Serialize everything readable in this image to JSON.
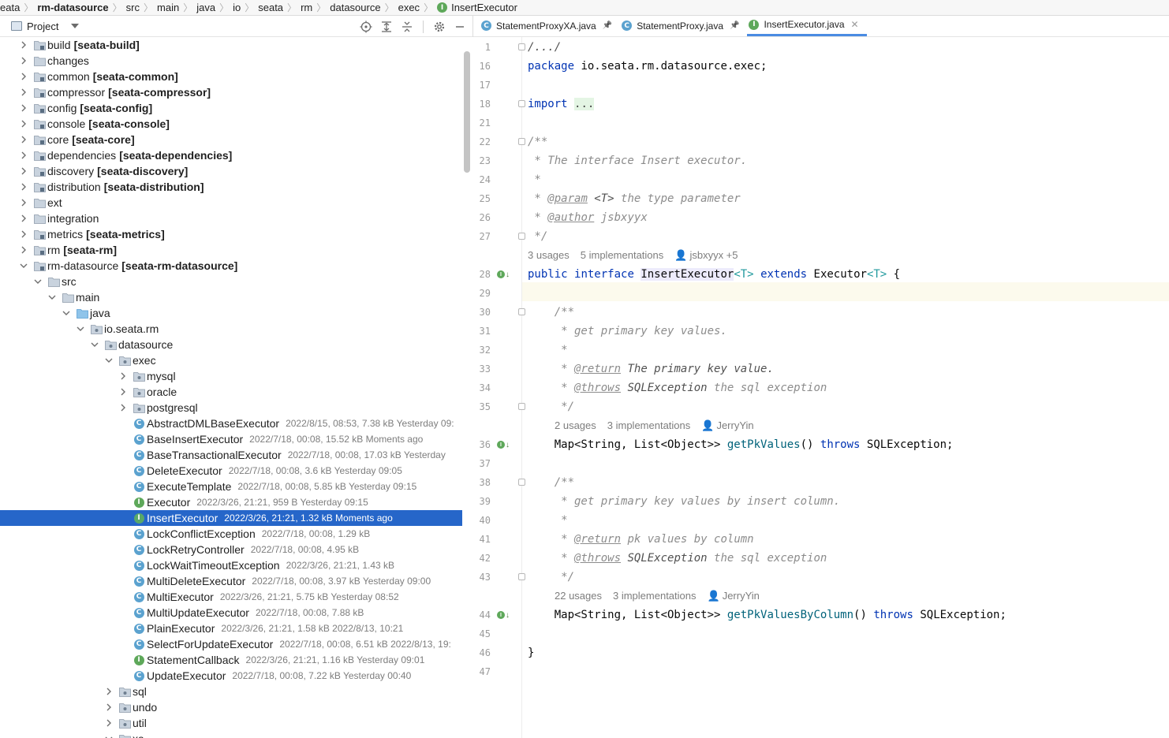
{
  "breadcrumb": [
    "eata",
    "rm-datasource",
    "src",
    "main",
    "java",
    "io",
    "seata",
    "rm",
    "datasource",
    "exec",
    "InsertExecutor"
  ],
  "project": {
    "title": "Project",
    "tree": [
      {
        "indent": 0,
        "arrow": "right",
        "icon": "module-folder",
        "name": "build",
        "mod": "[seata-build]"
      },
      {
        "indent": 0,
        "arrow": "right",
        "icon": "folder",
        "name": "changes",
        "mod": ""
      },
      {
        "indent": 0,
        "arrow": "right",
        "icon": "module-folder",
        "name": "common",
        "mod": "[seata-common]"
      },
      {
        "indent": 0,
        "arrow": "right",
        "icon": "module-folder",
        "name": "compressor",
        "mod": "[seata-compressor]"
      },
      {
        "indent": 0,
        "arrow": "right",
        "icon": "module-folder",
        "name": "config",
        "mod": "[seata-config]"
      },
      {
        "indent": 0,
        "arrow": "right",
        "icon": "module-folder",
        "name": "console",
        "mod": "[seata-console]"
      },
      {
        "indent": 0,
        "arrow": "right",
        "icon": "module-folder",
        "name": "core",
        "mod": "[seata-core]"
      },
      {
        "indent": 0,
        "arrow": "right",
        "icon": "module-folder",
        "name": "dependencies",
        "mod": "[seata-dependencies]"
      },
      {
        "indent": 0,
        "arrow": "right",
        "icon": "module-folder",
        "name": "discovery",
        "mod": "[seata-discovery]"
      },
      {
        "indent": 0,
        "arrow": "right",
        "icon": "module-folder",
        "name": "distribution",
        "mod": "[seata-distribution]"
      },
      {
        "indent": 0,
        "arrow": "right",
        "icon": "folder",
        "name": "ext",
        "mod": ""
      },
      {
        "indent": 0,
        "arrow": "right",
        "icon": "folder",
        "name": "integration",
        "mod": ""
      },
      {
        "indent": 0,
        "arrow": "right",
        "icon": "module-folder",
        "name": "metrics",
        "mod": "[seata-metrics]"
      },
      {
        "indent": 0,
        "arrow": "right",
        "icon": "module-folder",
        "name": "rm",
        "mod": "[seata-rm]"
      },
      {
        "indent": 0,
        "arrow": "down",
        "icon": "module-folder",
        "name": "rm-datasource",
        "mod": "[seata-rm-datasource]"
      },
      {
        "indent": 1,
        "arrow": "down",
        "icon": "folder",
        "name": "src",
        "mod": ""
      },
      {
        "indent": 2,
        "arrow": "down",
        "icon": "folder",
        "name": "main",
        "mod": ""
      },
      {
        "indent": 3,
        "arrow": "down",
        "icon": "src-folder",
        "name": "java",
        "mod": ""
      },
      {
        "indent": 4,
        "arrow": "down",
        "icon": "package",
        "name": "io.seata.rm",
        "mod": ""
      },
      {
        "indent": 5,
        "arrow": "down",
        "icon": "package",
        "name": "datasource",
        "mod": ""
      },
      {
        "indent": 6,
        "arrow": "down",
        "icon": "package",
        "name": "exec",
        "mod": ""
      },
      {
        "indent": 7,
        "arrow": "right",
        "icon": "package",
        "name": "mysql",
        "mod": ""
      },
      {
        "indent": 7,
        "arrow": "right",
        "icon": "package",
        "name": "oracle",
        "mod": ""
      },
      {
        "indent": 7,
        "arrow": "right",
        "icon": "package",
        "name": "postgresql",
        "mod": ""
      },
      {
        "indent": 7,
        "arrow": "none",
        "icon": "class",
        "name": "AbstractDMLBaseExecutor",
        "meta": "2022/8/15, 08:53, 7.38 kB Yesterday 09:"
      },
      {
        "indent": 7,
        "arrow": "none",
        "icon": "class",
        "name": "BaseInsertExecutor",
        "meta": "2022/7/18, 00:08, 15.52 kB Moments ago"
      },
      {
        "indent": 7,
        "arrow": "none",
        "icon": "class",
        "name": "BaseTransactionalExecutor",
        "meta": "2022/7/18, 00:08, 17.03 kB Yesterday"
      },
      {
        "indent": 7,
        "arrow": "none",
        "icon": "class",
        "name": "DeleteExecutor",
        "meta": "2022/7/18, 00:08, 3.6 kB Yesterday 09:05"
      },
      {
        "indent": 7,
        "arrow": "none",
        "icon": "class",
        "name": "ExecuteTemplate",
        "meta": "2022/7/18, 00:08, 5.85 kB Yesterday 09:15"
      },
      {
        "indent": 7,
        "arrow": "none",
        "icon": "interface",
        "name": "Executor",
        "meta": "2022/3/26, 21:21, 959 B Yesterday 09:15"
      },
      {
        "indent": 7,
        "arrow": "none",
        "icon": "interface",
        "name": "InsertExecutor",
        "meta": "2022/3/26, 21:21, 1.32 kB Moments ago",
        "selected": true
      },
      {
        "indent": 7,
        "arrow": "none",
        "icon": "class",
        "name": "LockConflictException",
        "meta": "2022/7/18, 00:08, 1.29 kB"
      },
      {
        "indent": 7,
        "arrow": "none",
        "icon": "class",
        "name": "LockRetryController",
        "meta": "2022/7/18, 00:08, 4.95 kB"
      },
      {
        "indent": 7,
        "arrow": "none",
        "icon": "class",
        "name": "LockWaitTimeoutException",
        "meta": "2022/3/26, 21:21, 1.43 kB"
      },
      {
        "indent": 7,
        "arrow": "none",
        "icon": "class",
        "name": "MultiDeleteExecutor",
        "meta": "2022/7/18, 00:08, 3.97 kB Yesterday 09:00"
      },
      {
        "indent": 7,
        "arrow": "none",
        "icon": "class",
        "name": "MultiExecutor",
        "meta": "2022/3/26, 21:21, 5.75 kB Yesterday 08:52"
      },
      {
        "indent": 7,
        "arrow": "none",
        "icon": "class",
        "name": "MultiUpdateExecutor",
        "meta": "2022/7/18, 00:08, 7.88 kB"
      },
      {
        "indent": 7,
        "arrow": "none",
        "icon": "class",
        "name": "PlainExecutor",
        "meta": "2022/3/26, 21:21, 1.58 kB 2022/8/13, 10:21"
      },
      {
        "indent": 7,
        "arrow": "none",
        "icon": "class",
        "name": "SelectForUpdateExecutor",
        "meta": "2022/7/18, 00:08, 6.51 kB 2022/8/13, 19:"
      },
      {
        "indent": 7,
        "arrow": "none",
        "icon": "interface",
        "name": "StatementCallback",
        "meta": "2022/3/26, 21:21, 1.16 kB Yesterday 09:01"
      },
      {
        "indent": 7,
        "arrow": "none",
        "icon": "class",
        "name": "UpdateExecutor",
        "meta": "2022/7/18, 00:08, 7.22 kB Yesterday 00:40"
      },
      {
        "indent": 6,
        "arrow": "right",
        "icon": "package",
        "name": "sql",
        "mod": ""
      },
      {
        "indent": 6,
        "arrow": "right",
        "icon": "package",
        "name": "undo",
        "mod": ""
      },
      {
        "indent": 6,
        "arrow": "right",
        "icon": "package",
        "name": "util",
        "mod": ""
      },
      {
        "indent": 6,
        "arrow": "down",
        "icon": "package",
        "name": "xa",
        "mod": ""
      }
    ]
  },
  "editor": {
    "tabs": [
      {
        "label": "StatementProxyXA.java",
        "icon": "class",
        "pinned": true,
        "active": false
      },
      {
        "label": "StatementProxy.java",
        "icon": "class",
        "pinned": true,
        "active": false
      },
      {
        "label": "InsertExecutor.java",
        "icon": "interface",
        "pinned": false,
        "active": true
      }
    ],
    "line_numbers": [
      "1",
      "16",
      "17",
      "18",
      "21",
      "22",
      "23",
      "24",
      "25",
      "26",
      "27",
      "",
      "28",
      "29",
      "30",
      "31",
      "32",
      "33",
      "34",
      "35",
      "",
      "36",
      "37",
      "38",
      "39",
      "40",
      "41",
      "42",
      "43",
      "",
      "44",
      "45",
      "46",
      "47"
    ],
    "hints": {
      "h1": {
        "usages": "3 usages",
        "impls": "5 implementations",
        "author": "jsbxyyx +5"
      },
      "h2": {
        "usages": "2 usages",
        "impls": "3 implementations",
        "author": "JerryYin"
      },
      "h3": {
        "usages": "22 usages",
        "impls": "3 implementations",
        "author": "JerryYin"
      }
    },
    "code": {
      "l1": "/.../",
      "l16_kw": "package",
      "l16_rest": " io.seata.rm.datasource.exec;",
      "l18_kw": "import",
      "l18_ph": "...",
      "l22": "/**",
      "l23": " * The interface Insert executor.",
      "l24": " *",
      "l25_pre": " * ",
      "l25_tag": "@param",
      "l25_t": " <T>",
      "l25_rest": " the type parameter",
      "l26_pre": " * ",
      "l26_tag": "@author",
      "l26_rest": " jsbxyyx",
      "l27": " */",
      "l28_public": "public",
      "l28_interface": "interface",
      "l28_name": "InsertExecutor",
      "l28_T": "<T>",
      "l28_extends": "extends",
      "l28_exec": "Executor",
      "l28_T2": "<T>",
      "l28_brace": " {",
      "l30": "    /**",
      "l31": "     * get primary key values.",
      "l32": "     *",
      "l33_pre": "     * ",
      "l33_tag": "@return",
      "l33_rest": " The primary key value.",
      "l34_pre": "     * ",
      "l34_tag": "@throws",
      "l34_ex": " SQLException",
      "l34_rest": " the sql exception",
      "l35": "     */",
      "l36_type": "    Map<String, List<Object>> ",
      "l36_fn": "getPkValues",
      "l36_paren": "() ",
      "l36_throws": "throws",
      "l36_rest": " SQLException;",
      "l38": "    /**",
      "l39": "     * get primary key values by insert column.",
      "l40": "     *",
      "l41_pre": "     * ",
      "l41_tag": "@return",
      "l41_rest": " pk values by column",
      "l42_pre": "     * ",
      "l42_tag": "@throws",
      "l42_ex": " SQLException",
      "l42_rest": " the sql exception",
      "l43": "     */",
      "l44_type": "    Map<String, List<Object>> ",
      "l44_fn": "getPkValuesByColumn",
      "l44_paren": "() ",
      "l44_throws": "throws",
      "l44_rest": " SQLException;",
      "l46": "}"
    }
  },
  "colors": {
    "selection": "#2666c9",
    "class_icon": "#5ba2cf",
    "interface_icon": "#5ea85a",
    "keyword": "#0033b3",
    "comment": "#8c8c8c"
  }
}
